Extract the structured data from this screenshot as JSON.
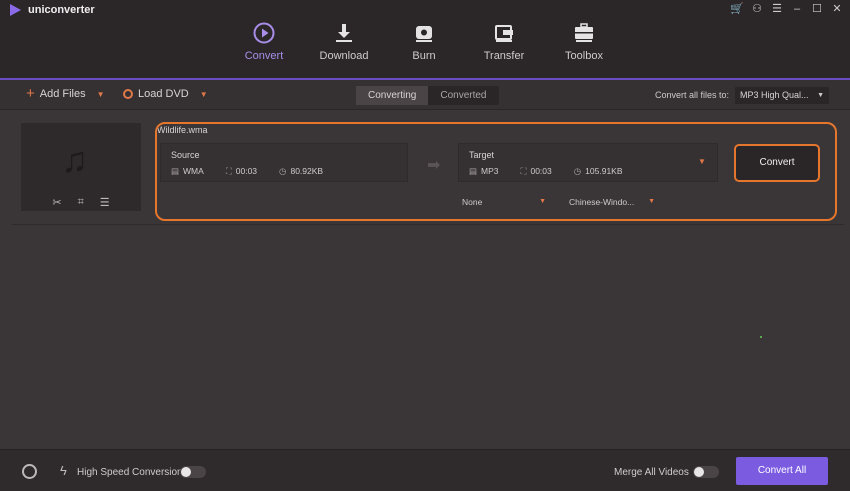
{
  "app": {
    "name": "uniconverter"
  },
  "nav": [
    {
      "label": "Convert",
      "icon": "play-circle-icon",
      "active": true
    },
    {
      "label": "Download",
      "icon": "download-icon"
    },
    {
      "label": "Burn",
      "icon": "disc-icon"
    },
    {
      "label": "Transfer",
      "icon": "transfer-icon"
    },
    {
      "label": "Toolbox",
      "icon": "toolbox-icon"
    }
  ],
  "toolbar": {
    "add_files": "Add Files",
    "load_dvd": "Load DVD",
    "tabs": [
      "Converting",
      "Converted"
    ],
    "convert_all_to_label": "Convert all files to:",
    "format_value": "MP3 High Qual..."
  },
  "file": {
    "name": "Wildlife.wma",
    "source": {
      "title": "Source",
      "format": "WMA",
      "duration": "00:03",
      "size": "80.92KB"
    },
    "target": {
      "title": "Target",
      "format": "MP3",
      "duration": "00:03",
      "size": "105.91KB"
    },
    "convert_label": "Convert",
    "subtitle_value": "None",
    "audio_track_value": "Chinese-Windo..."
  },
  "bottom": {
    "high_speed_label": "High Speed Conversion",
    "merge_label": "Merge All Videos",
    "convert_all_label": "Convert All"
  },
  "colors": {
    "accent": "#7b5ce0",
    "highlight": "#e4762d",
    "orange": "#e0784a"
  }
}
